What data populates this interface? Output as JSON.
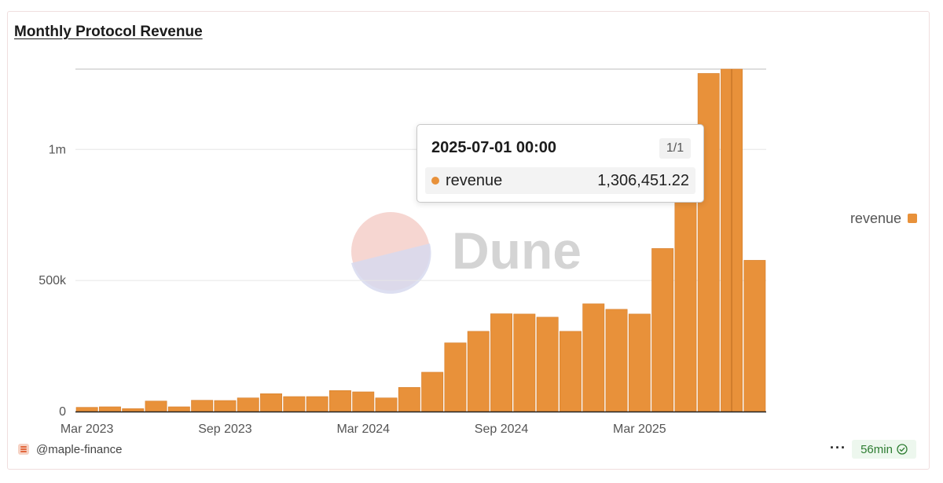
{
  "title": "Monthly Protocol Revenue",
  "watermark": "Dune",
  "author": "@maple-finance",
  "more_label": "···",
  "refresh_badge": "56min",
  "icons": {
    "author": "stacked-layers-icon",
    "badge": "check-circle-icon",
    "watermark": "dune-logo-icon"
  },
  "colors": {
    "bar": "#e8913a",
    "grid": "#e6e6e6",
    "axis_text": "#555555",
    "badge_text": "#2e7d32"
  },
  "tooltip": {
    "date": "2025-07-01 00:00",
    "page": "1/1",
    "series": "revenue",
    "value": "1,306,451.22"
  },
  "legend": {
    "series": "revenue",
    "position": "right"
  },
  "chart_data": {
    "type": "bar",
    "title": "Monthly Protocol Revenue",
    "xlabel": "",
    "ylabel": "",
    "ylim": [
      0,
      1306451.22
    ],
    "grid": true,
    "legend": "right",
    "x_tick_labels": [
      "Mar 2023",
      "Sep 2023",
      "Mar 2024",
      "Sep 2024",
      "Mar 2025"
    ],
    "y_tick_labels": [
      "0",
      "500k",
      "1m"
    ],
    "y_ticks": [
      0,
      500000,
      1000000
    ],
    "categories": [
      "2023-03",
      "2023-04",
      "2023-05",
      "2023-06",
      "2023-07",
      "2023-08",
      "2023-09",
      "2023-10",
      "2023-11",
      "2023-12",
      "2024-01",
      "2024-02",
      "2024-03",
      "2024-04",
      "2024-05",
      "2024-06",
      "2024-07",
      "2024-08",
      "2024-09",
      "2024-10",
      "2024-11",
      "2024-12",
      "2025-01",
      "2025-02",
      "2025-03",
      "2025-04",
      "2025-05",
      "2025-06",
      "2025-07",
      "2025-08"
    ],
    "series": [
      {
        "name": "revenue",
        "values": [
          16000,
          18000,
          11000,
          40000,
          18000,
          43000,
          42000,
          52000,
          68000,
          57000,
          57000,
          80000,
          75000,
          52000,
          92000,
          150000,
          262000,
          306000,
          373000,
          372000,
          360000,
          306000,
          411000,
          390000,
          372000,
          622000,
          1000000,
          1290000,
          1306451.22,
          577000
        ]
      }
    ],
    "highlight_category": "2025-07"
  }
}
